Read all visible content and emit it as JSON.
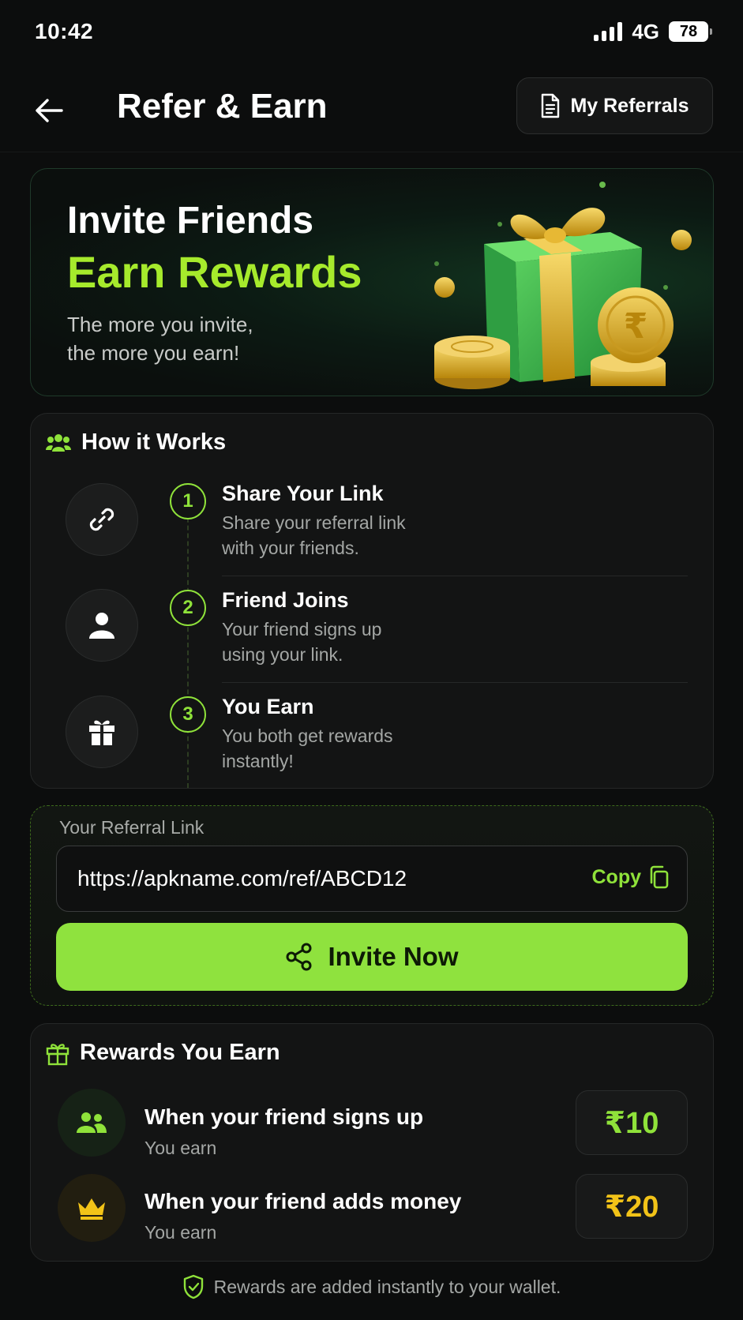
{
  "status_bar": {
    "time": "10:42",
    "network": "4G",
    "battery": "78"
  },
  "header": {
    "title": "Refer & Earn",
    "my_referrals_label": "My Referrals"
  },
  "banner": {
    "line1": "Invite Friends",
    "line2": "Earn Rewards",
    "sub1": "The more you invite,",
    "sub2": "the more you earn!"
  },
  "how_it_works": {
    "title": "How it Works",
    "steps": [
      {
        "number": "1",
        "title": "Share Your Link",
        "desc1": "Share your referral link",
        "desc2": "with your friends.",
        "icon": "link-icon"
      },
      {
        "number": "2",
        "title": "Friend Joins",
        "desc1": "Your friend signs up",
        "desc2": "using your link.",
        "icon": "user-icon"
      },
      {
        "number": "3",
        "title": "You Earn",
        "desc1": "You both get rewards",
        "desc2": "instantly!",
        "icon": "gift-icon"
      }
    ]
  },
  "referral": {
    "label": "Your Referral Link",
    "url": "https://apkname.com/ref/ABCD12",
    "copy_label": "Copy",
    "invite_label": "Invite Now"
  },
  "rewards": {
    "title": "Rewards You Earn",
    "items": [
      {
        "title": "When your friend signs up",
        "sub": "You earn",
        "amount": "₹10",
        "amount_color": "#8fe23a",
        "icon": "users-icon"
      },
      {
        "title": "When your friend adds money",
        "sub": "You earn",
        "amount": "₹20",
        "amount_color": "#f2c318",
        "icon": "crown-icon"
      }
    ]
  },
  "footer": {
    "note": "Rewards are added instantly to your wallet."
  },
  "colors": {
    "accent": "#8fe23e",
    "gold": "#f2c318",
    "background": "#0c0d0d"
  }
}
